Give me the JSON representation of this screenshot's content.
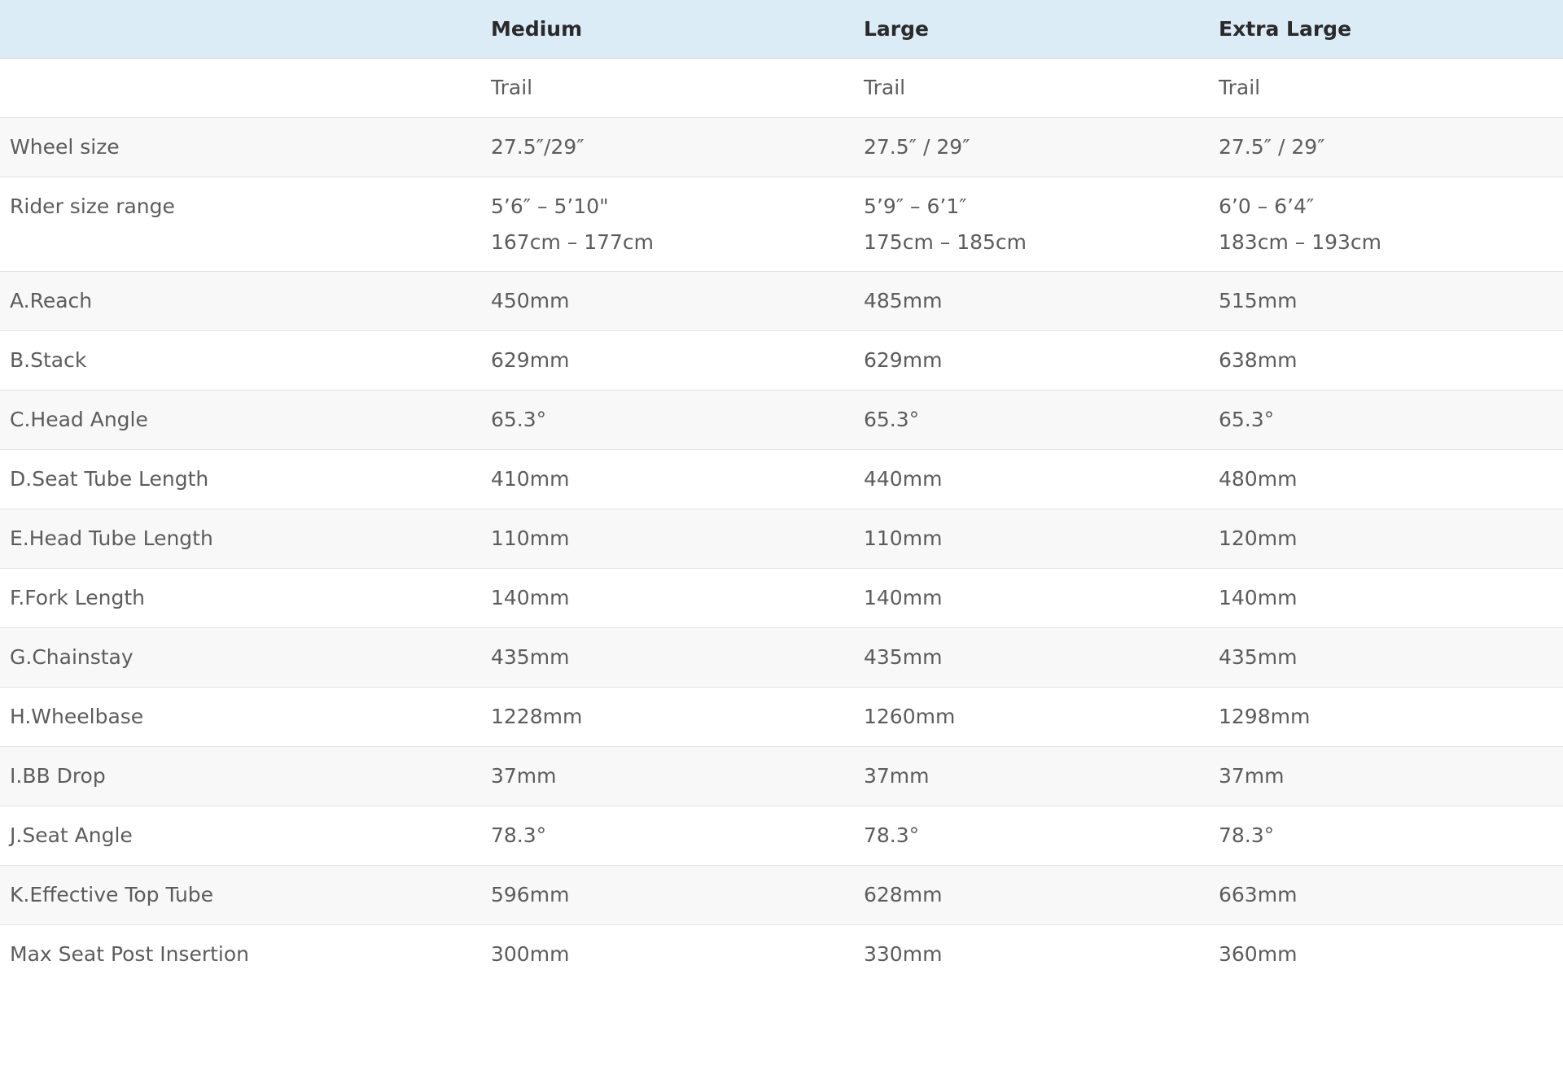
{
  "header": {
    "corner": "",
    "columns": [
      "Medium",
      "Large",
      "Extra Large"
    ]
  },
  "rows": [
    {
      "label": "",
      "values": [
        [
          "Trail"
        ],
        [
          "Trail"
        ],
        [
          "Trail"
        ]
      ]
    },
    {
      "label": "Wheel size",
      "values": [
        [
          "27.5″/29″"
        ],
        [
          "27.5″ / 29″"
        ],
        [
          "27.5″ / 29″"
        ]
      ]
    },
    {
      "label": "Rider size range",
      "values": [
        [
          "5’6″ – 5’10\"",
          "167cm – 177cm"
        ],
        [
          "5’9″ – 6’1″",
          "175cm – 185cm"
        ],
        [
          "6’0 – 6’4″",
          "183cm – 193cm"
        ]
      ]
    },
    {
      "label": "A.Reach",
      "values": [
        [
          "450mm"
        ],
        [
          "485mm"
        ],
        [
          "515mm"
        ]
      ]
    },
    {
      "label": "B.Stack",
      "values": [
        [
          "629mm"
        ],
        [
          "629mm"
        ],
        [
          "638mm"
        ]
      ]
    },
    {
      "label": "C.Head Angle",
      "values": [
        [
          "65.3°"
        ],
        [
          "65.3°"
        ],
        [
          "65.3°"
        ]
      ]
    },
    {
      "label": "D.Seat Tube Length",
      "values": [
        [
          "410mm"
        ],
        [
          "440mm"
        ],
        [
          "480mm"
        ]
      ]
    },
    {
      "label": "E.Head Tube Length",
      "values": [
        [
          "110mm"
        ],
        [
          "110mm"
        ],
        [
          "120mm"
        ]
      ]
    },
    {
      "label": "F.Fork Length",
      "values": [
        [
          "140mm"
        ],
        [
          "140mm"
        ],
        [
          "140mm"
        ]
      ]
    },
    {
      "label": "G.Chainstay",
      "values": [
        [
          "435mm"
        ],
        [
          "435mm"
        ],
        [
          "435mm"
        ]
      ]
    },
    {
      "label": "H.Wheelbase",
      "values": [
        [
          "1228mm"
        ],
        [
          "1260mm"
        ],
        [
          "1298mm"
        ]
      ]
    },
    {
      "label": "I.BB Drop",
      "values": [
        [
          "37mm"
        ],
        [
          "37mm"
        ],
        [
          "37mm"
        ]
      ]
    },
    {
      "label": "J.Seat Angle",
      "values": [
        [
          "78.3°"
        ],
        [
          "78.3°"
        ],
        [
          "78.3°"
        ]
      ]
    },
    {
      "label": "K.Effective Top Tube",
      "values": [
        [
          "596mm"
        ],
        [
          "628mm"
        ],
        [
          "663mm"
        ]
      ]
    },
    {
      "label": "Max Seat Post Insertion",
      "values": [
        [
          "300mm"
        ],
        [
          "330mm"
        ],
        [
          "360mm"
        ]
      ]
    }
  ]
}
